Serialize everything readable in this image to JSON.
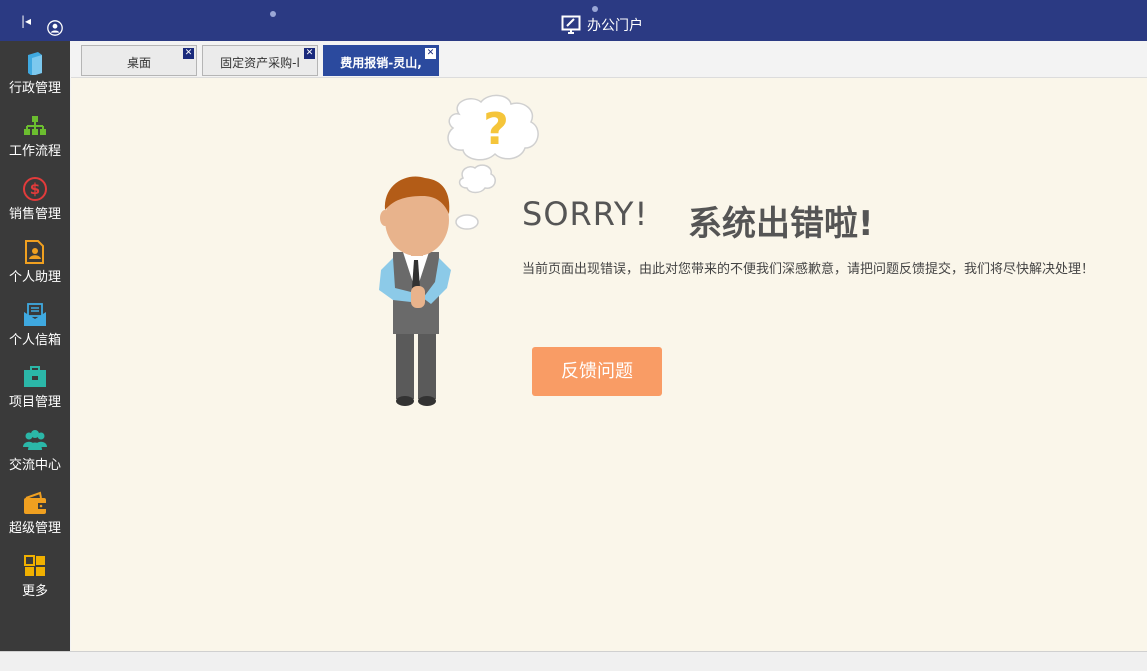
{
  "header": {
    "title": "办公门户",
    "collapse_icon": "collapse-left-icon",
    "user_icon": "user-icon"
  },
  "sidebar": {
    "items": [
      {
        "label": "行政管理",
        "icon": "book-icon",
        "color": "#3fa9e0"
      },
      {
        "label": "工作流程",
        "icon": "org-chart-icon",
        "color": "#6bbd2f"
      },
      {
        "label": "销售管理",
        "icon": "dollar-icon",
        "color": "#e23b3b"
      },
      {
        "label": "个人助理",
        "icon": "assistant-icon",
        "color": "#f0a020"
      },
      {
        "label": "个人信箱",
        "icon": "mail-icon",
        "color": "#3fa9e0"
      },
      {
        "label": "项目管理",
        "icon": "briefcase-icon",
        "color": "#2bb7a8"
      },
      {
        "label": "交流中心",
        "icon": "people-icon",
        "color": "#2bb7a8"
      },
      {
        "label": "超级管理",
        "icon": "wallet-icon",
        "color": "#f0a020"
      },
      {
        "label": "更多",
        "icon": "grid-icon",
        "color": "#f0b000"
      }
    ]
  },
  "tabs": [
    {
      "label": "桌面",
      "active": false
    },
    {
      "label": "固定资产采购-l",
      "active": false
    },
    {
      "label": "费用报销-灵山,",
      "active": true
    }
  ],
  "error": {
    "sorry": "SORRY!",
    "title_cn": "系统出错啦!",
    "message": "当前页面出现错误，由此对您带来的不便我们深感歉意，请把问题反馈提交，我们将尽快解决处理！",
    "button_label": "反馈问题",
    "button_color": "#f99c65",
    "bubble_mark": "?"
  }
}
